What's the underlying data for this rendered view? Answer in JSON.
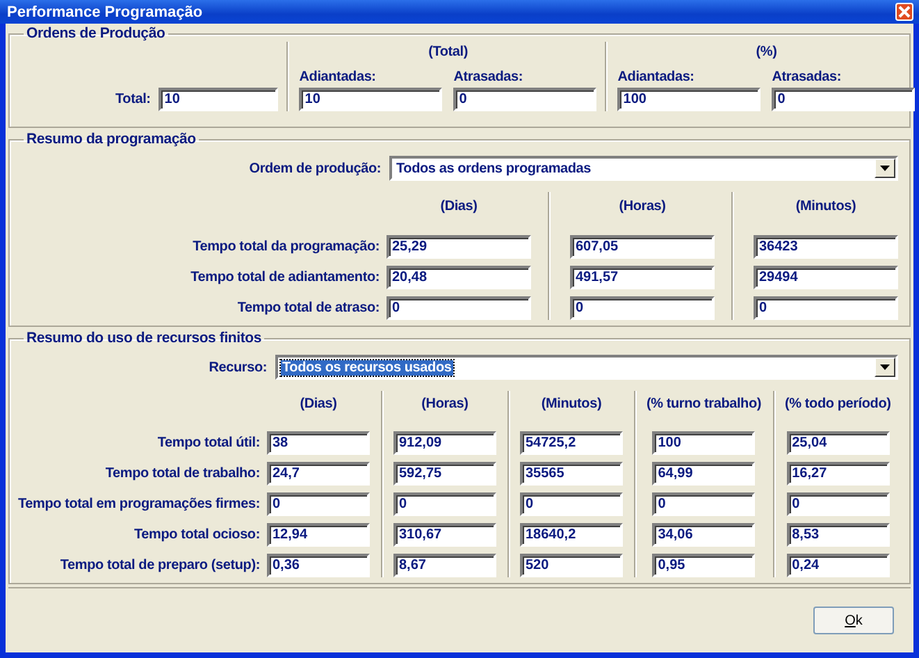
{
  "window": {
    "title": "Performance Programação"
  },
  "ordens_de_producao": {
    "title": "Ordens de Produção",
    "total": {
      "label": "Total:",
      "value": "10"
    },
    "groups": [
      {
        "heading": "(Total)",
        "fields": [
          {
            "label": "Adiantadas:",
            "value": "10"
          },
          {
            "label": "Atrasadas:",
            "value": "0"
          }
        ]
      },
      {
        "heading": "(%)",
        "fields": [
          {
            "label": "Adiantadas:",
            "value": "100"
          },
          {
            "label": "Atrasadas:",
            "value": "0"
          }
        ]
      }
    ]
  },
  "resumo_programacao": {
    "title": "Resumo da programação",
    "selector": {
      "label": "Ordem de produção:",
      "value": "Todos as ordens programadas",
      "highlighted": false
    },
    "columns": [
      "(Dias)",
      "(Horas)",
      "(Minutos)"
    ],
    "rows": [
      {
        "label": "Tempo total da programação:",
        "values": [
          "25,29",
          "607,05",
          "36423"
        ]
      },
      {
        "label": "Tempo total de adiantamento:",
        "values": [
          "20,48",
          "491,57",
          "29494"
        ]
      },
      {
        "label": "Tempo total de atraso:",
        "values": [
          "0",
          "0",
          "0"
        ]
      }
    ]
  },
  "resumo_recursos": {
    "title": "Resumo do uso de recursos finitos",
    "selector": {
      "label": "Recurso:",
      "value": "Todos os recursos usados",
      "highlighted": true
    },
    "columns": [
      "(Dias)",
      "(Horas)",
      "(Minutos)",
      "(% turno trabalho)",
      "(% todo período)"
    ],
    "rows": [
      {
        "label": "Tempo total útil:",
        "values": [
          "38",
          "912,09",
          "54725,2",
          "100",
          "25,04"
        ]
      },
      {
        "label": "Tempo total de trabalho:",
        "values": [
          "24,7",
          "592,75",
          "35565",
          "64,99",
          "16,27"
        ]
      },
      {
        "label": "Tempo total em programações firmes:",
        "values": [
          "0",
          "0",
          "0",
          "0",
          "0"
        ]
      },
      {
        "label": "Tempo total ocioso:",
        "values": [
          "12,94",
          "310,67",
          "18640,2",
          "34,06",
          "8,53"
        ]
      },
      {
        "label": "Tempo total de preparo (setup):",
        "values": [
          "0,36",
          "8,67",
          "520",
          "0,95",
          "0,24"
        ]
      }
    ]
  },
  "buttons": [
    {
      "label": "Ok"
    }
  ]
}
